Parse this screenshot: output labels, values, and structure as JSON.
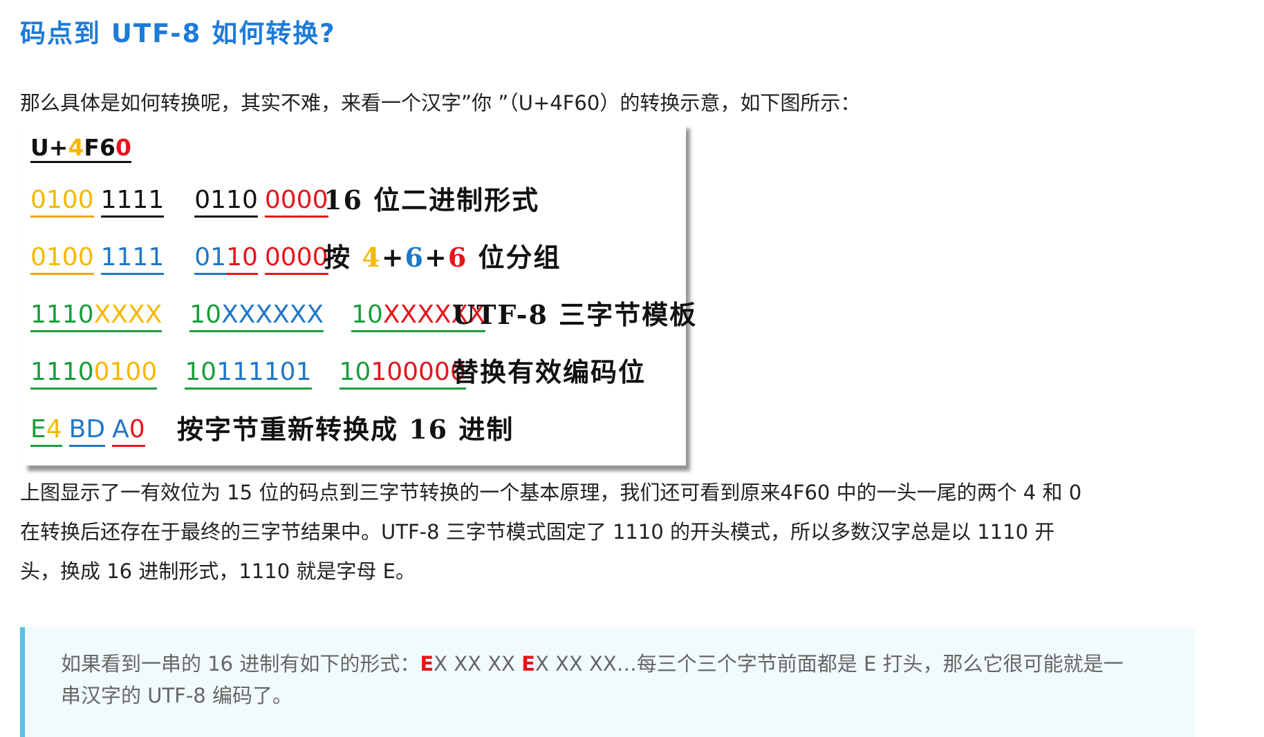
{
  "heading": "码点到 UTF-8 如何转换?",
  "intro": "那么具体是如何转换呢，其实不难，来看一个汉字”你 ”（U+4F60）的转换示意，如下图所示：",
  "figure": {
    "row0": {
      "prefix": "U+",
      "d1": "4",
      "d2": "F6",
      "d3": "0"
    },
    "row1": {
      "g1": "0100",
      "g2": "1111",
      "g3": "0110",
      "g4": "0000",
      "desc": "16 位二进制形式"
    },
    "row2": {
      "g1": "0100",
      "g2": "1111",
      "g3a": "01",
      "g3b": "10",
      "g4": "0000",
      "desc_a": "按 ",
      "n1": "4",
      "plus1": "+",
      "n2": "6",
      "plus2": "+",
      "n3": "6",
      "desc_b": " 位分组"
    },
    "row3": {
      "a1": "1110",
      "a2": "XXXX",
      "b1": "10",
      "b2": "XXXXXX",
      "c1": "10",
      "c2": "XXXXXX",
      "desc": "UTF-8 三字节模板"
    },
    "row4": {
      "a1": "1110",
      "a2": "0100",
      "b1": "10",
      "b2": "111101",
      "c1": "10",
      "c2": "100000",
      "desc": "替换有效编码位"
    },
    "row5": {
      "h1": "E",
      "h2": "4",
      "h3": "BD",
      "h4": "A",
      "h5": "0",
      "desc": "按字节重新转换成 16 进制"
    }
  },
  "explain": [
    "上图显示了一有效位为 15 位的码点到三字节转换的一个基本原理，我们还可看到原来4F60 中的一头一尾的两个 4 和 0",
    "在转换后还存在于最终的三字节结果中。UTF-8 三字节模式固定了 1110 的开头模式，所以多数汉字总是以 1110 开",
    "头，换成 16 进制形式，1110 就是字母 E。"
  ],
  "callout": {
    "line1_a": "如果看到一串的 16 进制有如下的形式：",
    "e1": "E",
    "line1_b": "X XX XX ",
    "e2": "E",
    "line1_c": "X XX XX…每三个三个字节前面都是 E 打头，那么它很可能就是一",
    "line2": "串汉字的 UTF-8 编码了。"
  },
  "colors": {
    "heading": "#1e7bd6",
    "orange": "#f5b800",
    "blue": "#1f77c9",
    "red": "#e8141b",
    "green": "#1a9e3b",
    "callout_bg": "#f1fafc",
    "callout_border": "#58c0e2"
  }
}
